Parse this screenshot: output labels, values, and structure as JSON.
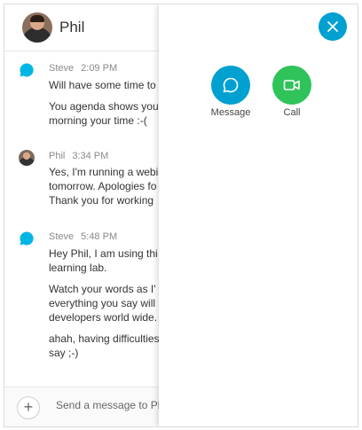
{
  "header": {
    "name": "Phil"
  },
  "messages": [
    {
      "sender": "Steve",
      "time": "2:09 PM",
      "avatar": "chat-bubble-icon",
      "lines": [
        "Will have some time to",
        "You agenda shows you",
        "morning your time :-("
      ]
    },
    {
      "sender": "Phil",
      "time": "3:34 PM",
      "avatar": "user-photo",
      "lines": [
        "Yes, I'm running a webi",
        "tomorrow. Apologies fo",
        "Thank you for working"
      ]
    },
    {
      "sender": "Steve",
      "time": "5:48 PM",
      "avatar": "chat-bubble-icon",
      "lines": [
        "Hey Phil, I am using thi",
        "learning lab.",
        "Watch your words as I'",
        "everything you say will",
        "developers world wide.",
        "ahah, having difficulties",
        "say ;-)"
      ]
    }
  ],
  "composer": {
    "placeholder": "Send a message to Phil"
  },
  "panel": {
    "actions": [
      {
        "label": "Message",
        "icon": "message-icon",
        "color": "#00a0d1"
      },
      {
        "label": "Call",
        "icon": "video-camera-icon",
        "color": "#2fc35a"
      }
    ],
    "close_icon": "close-icon"
  },
  "colors": {
    "accent": "#00a0d1",
    "call_green": "#2fc35a"
  }
}
